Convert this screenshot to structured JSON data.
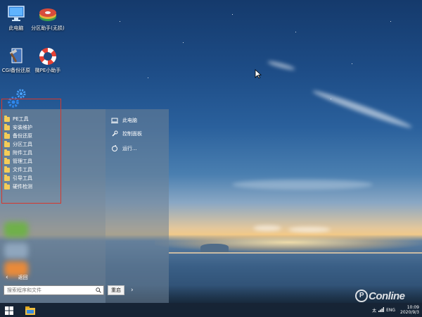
{
  "desktop": {
    "icons": [
      {
        "name": "this-pc",
        "label": "此电脑",
        "icon": "monitor-icon"
      },
      {
        "name": "partition-assistant",
        "label": "分区助手(无损)",
        "icon": "partition-disk-icon"
      },
      {
        "name": "cgi-backup",
        "label": "CGI备份还原",
        "icon": "hammer-tool-icon"
      },
      {
        "name": "pe-helper",
        "label": "微PE小助手",
        "icon": "lifebuoy-icon"
      }
    ]
  },
  "start_menu": {
    "folders": [
      {
        "label": "PE工具"
      },
      {
        "label": "安装维护"
      },
      {
        "label": "备份还原"
      },
      {
        "label": "分区工具"
      },
      {
        "label": "附件工具"
      },
      {
        "label": "管理工具"
      },
      {
        "label": "文件工具"
      },
      {
        "label": "引导工具"
      },
      {
        "label": "硬件检测"
      }
    ],
    "right_items": [
      {
        "label": "此电脑",
        "icon": "computer-icon"
      },
      {
        "label": "控制面板",
        "icon": "wrench-icon"
      },
      {
        "label": "运行...",
        "icon": "run-icon"
      }
    ],
    "back_label": "返回",
    "search": {
      "placeholder": "搜索程序和文件"
    },
    "restart_label": "重启"
  },
  "taskbar": {
    "ime": "ENG",
    "tray_prefix": "太",
    "time_lines": [
      "10:09",
      "2020/9/3"
    ]
  },
  "watermark": {
    "text": "Conline"
  },
  "colors": {
    "highlight_border": "#d7382c",
    "folder": "#f4cc58",
    "taskbar": "#141e2d"
  }
}
